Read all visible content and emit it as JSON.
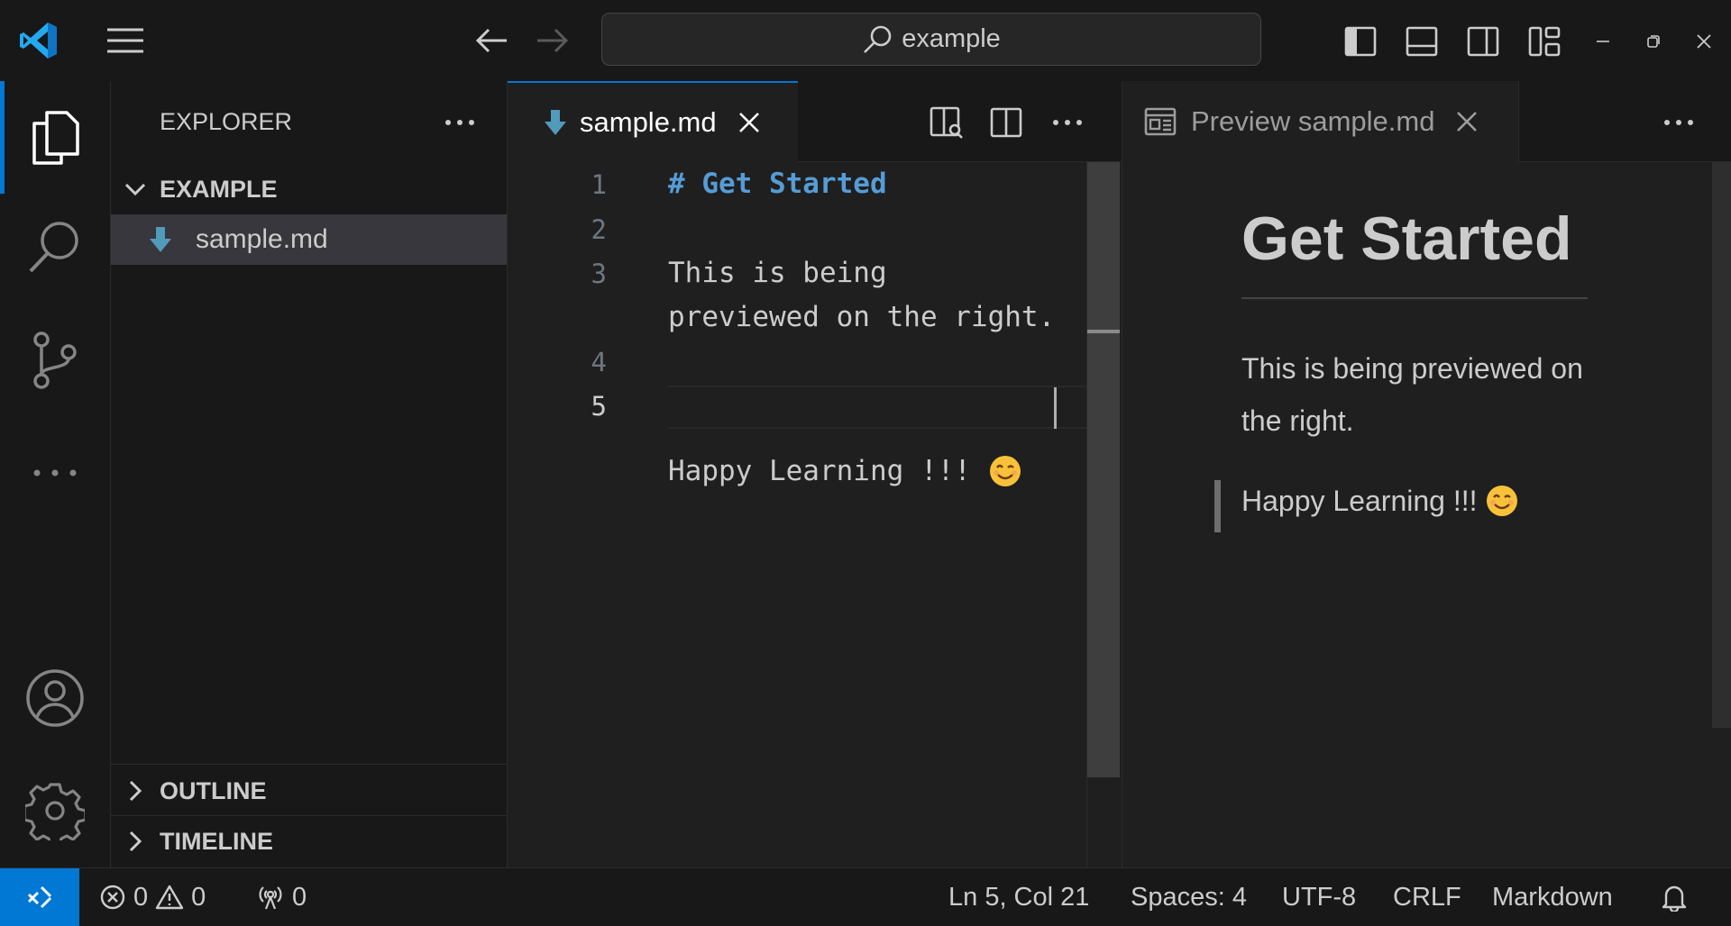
{
  "titlebar": {
    "search_text": "example"
  },
  "sidebar": {
    "title": "EXPLORER",
    "folder_name": "EXAMPLE",
    "file_name": "sample.md",
    "outline_label": "OUTLINE",
    "timeline_label": "TIMELINE"
  },
  "editor": {
    "tab_label": "sample.md",
    "lines": [
      {
        "number": "1",
        "text": "# Get Started"
      },
      {
        "number": "2",
        "text": ""
      },
      {
        "number": "3",
        "text": "This is being"
      },
      {
        "number": "",
        "text": "previewed on the right."
      },
      {
        "number": "4",
        "text": ""
      },
      {
        "number": "5",
        "text": "Happy Learning !!! "
      }
    ]
  },
  "preview": {
    "tab_label": "Preview sample.md",
    "heading": "Get Started",
    "paragraph": "This is being previewed on the right.",
    "quote": "Happy Learning !!! "
  },
  "statusbar": {
    "errors": "0",
    "warnings": "0",
    "ports": "0",
    "position": "Ln 5, Col 21",
    "spaces": "Spaces: 4",
    "encoding": "UTF-8",
    "eol": "CRLF",
    "language": "Markdown"
  },
  "colors": {
    "accent": "#0078d4",
    "heading_syntax": "#569cd6",
    "markdown_icon": "#519aba"
  }
}
